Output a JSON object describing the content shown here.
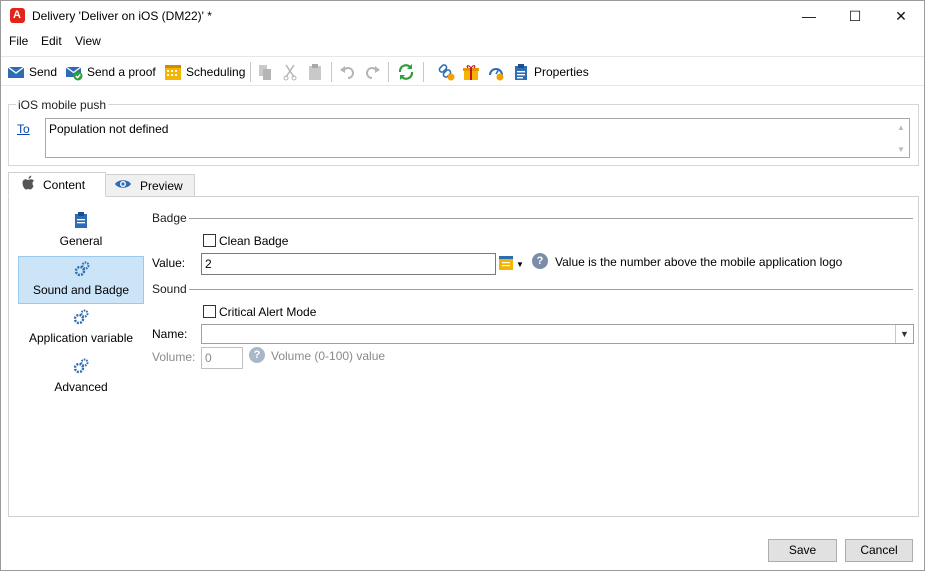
{
  "window": {
    "title": "Delivery 'Deliver on iOS (DM22)' *",
    "minimize_glyph": "—",
    "maximize_glyph": "☐",
    "close_glyph": "✕"
  },
  "menu": {
    "items": [
      "File",
      "Edit",
      "View"
    ]
  },
  "toolbar": {
    "send_label": "Send",
    "send_proof_label": "Send a proof",
    "scheduling_label": "Scheduling",
    "properties_label": "Properties"
  },
  "header_group": {
    "title": "iOS mobile push",
    "to_label": "To",
    "to_value": "Population not defined"
  },
  "tabs": [
    {
      "label": "Content",
      "icon": "apple-icon"
    },
    {
      "label": "Preview",
      "icon": "eye-icon"
    }
  ],
  "sidebar": {
    "items": [
      {
        "label": "General",
        "icon": "clipboard-icon"
      },
      {
        "label": "Sound and Badge",
        "icon": "gears-icon"
      },
      {
        "label": "Application variable",
        "icon": "gears-icon"
      },
      {
        "label": "Advanced",
        "icon": "gears-icon"
      }
    ],
    "selected": "Sound and Badge"
  },
  "badge_section": {
    "title": "Badge",
    "clean_badge_label": "Clean Badge",
    "clean_badge_checked": false,
    "value_label": "Value:",
    "value": "2",
    "help_text": "Value is the number above the mobile application logo"
  },
  "sound_section": {
    "title": "Sound",
    "critical_alert_label": "Critical Alert Mode",
    "critical_alert_checked": false,
    "name_label": "Name:",
    "name_value": "",
    "volume_label": "Volume:",
    "volume_value": "0",
    "volume_help": "Volume (0-100) value"
  },
  "footer": {
    "save_label": "Save",
    "cancel_label": "Cancel"
  },
  "colors": {
    "selected_bg": "#cce4f7",
    "link": "#0645ad",
    "app_icon": "#e1251b",
    "help_icon": "#7c8ea7"
  }
}
